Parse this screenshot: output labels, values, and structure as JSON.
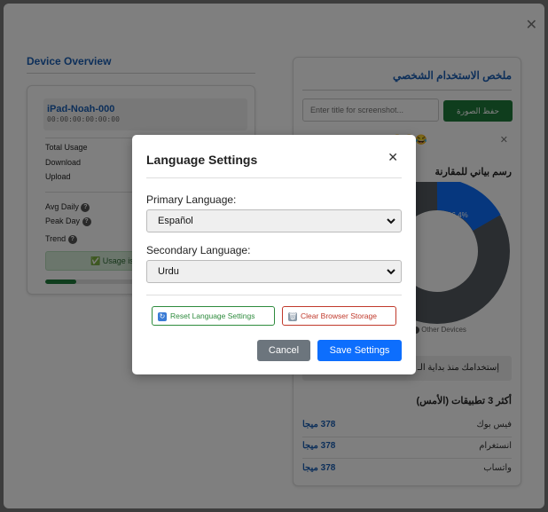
{
  "background": {
    "left_panel": {
      "title": "Device Overview",
      "device_name": "iPad-Noah-000",
      "device_mac": "00:00:00:00:00:00",
      "stats": {
        "total_usage": "Total Usage",
        "download": "Download",
        "upload": "Upload",
        "avg_daily": "Avg Daily",
        "peak_day": "Peak Day",
        "trend": "Trend"
      },
      "status_text": "✅ Usage is w",
      "progress_fraction": 0.15
    },
    "right_panel": {
      "title": "ملخص الاستخدام الشخصي",
      "screenshot_title_placeholder": "Enter title for screenshot...",
      "save_image_button": "حفظ الصورة",
      "emojis": "😊😄😂",
      "chart_title": "رسم بياني للمقارنة",
      "donut_label": "16.4%",
      "legend_other": "Other Devices",
      "since_text": "إستخدامك منذ بداية الـ",
      "top_apps_title": "أكثر 3 تطبيقات (الأمس)",
      "apps": [
        {
          "name": "فيس بوك",
          "value": "378 ميجا"
        },
        {
          "name": "انستغرام",
          "value": "378 ميجا"
        },
        {
          "name": "واتساب",
          "value": "378 ميجا"
        }
      ]
    }
  },
  "modal": {
    "title": "Language Settings",
    "primary_label": "Primary Language:",
    "primary_value": "Español",
    "secondary_label": "Secondary Language:",
    "secondary_value": "Urdu",
    "reset_button": "Reset Language Settings",
    "clear_button": "Clear Browser Storage",
    "cancel_button": "Cancel",
    "save_button": "Save Settings"
  },
  "colors": {
    "accent": "#0d6efd",
    "brand_blue": "#1a5fb4",
    "success": "#1e7a3a",
    "danger": "#c0392b",
    "muted_button": "#6c757d"
  }
}
